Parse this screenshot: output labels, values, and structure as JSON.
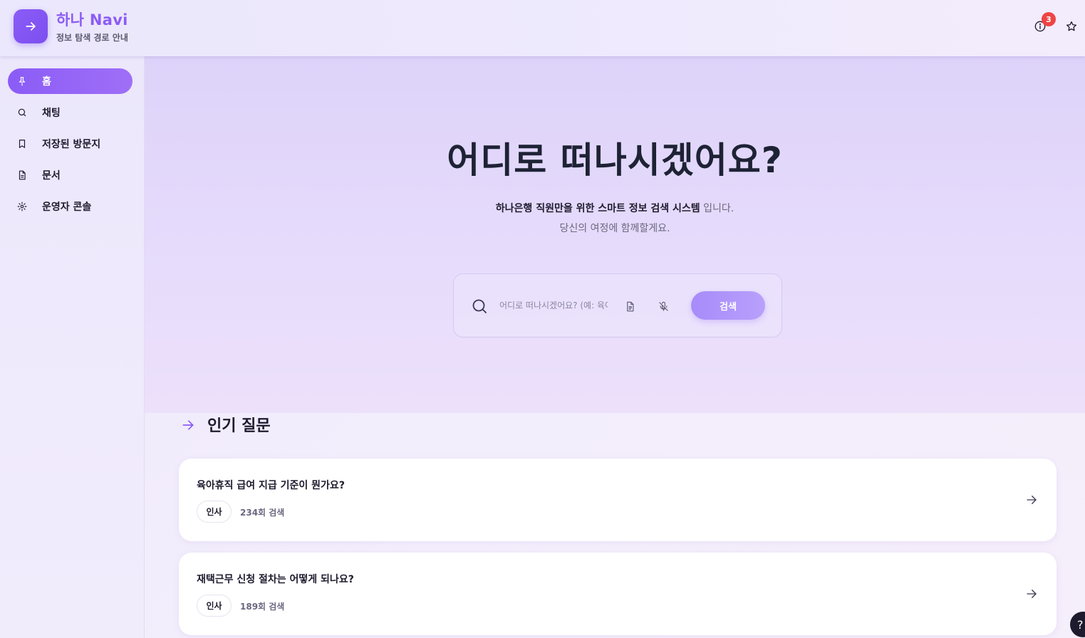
{
  "header": {
    "title": "하나 Navi",
    "subtitle": "정보 탐색 경로 안내",
    "notification_count": "3",
    "icons": [
      "arrow-right-icon",
      "info-icon",
      "star-icon"
    ]
  },
  "sidebar": {
    "items": [
      {
        "label": "홈",
        "icon": "pin-icon",
        "active": true
      },
      {
        "label": "채팅",
        "icon": "search-icon",
        "active": false
      },
      {
        "label": "저장된 방문지",
        "icon": "bookmark-icon",
        "active": false
      },
      {
        "label": "문서",
        "icon": "document-icon",
        "active": false
      },
      {
        "label": "운영자 콘솔",
        "icon": "gear-icon",
        "active": false
      }
    ]
  },
  "hero": {
    "title": "어디로 떠나시겠어요?",
    "line1_bold": "하나은행 직원만을 위한 스마트 정보 검색 시스템",
    "line1_tail": " 입니다.",
    "line2": "당신의 여정에 함께할게요."
  },
  "search": {
    "placeholder": "어디로 떠나시겠어요? (예: 육아휴직 급여)",
    "value": "",
    "button_label": "검색"
  },
  "popular": {
    "title": "인기 질문",
    "questions": [
      {
        "text": "육아휴직 급여 지급 기준이 뭔가요?",
        "tag": "인사",
        "count": "234회 검색"
      },
      {
        "text": "재택근무 신청 절차는 어떻게 되나요?",
        "tag": "인사",
        "count": "189회 검색"
      }
    ]
  },
  "help": {
    "label": "?"
  },
  "colors": {
    "accent": "#8b5cf6",
    "badge": "#ef4444",
    "text": "#1e1b2e"
  }
}
